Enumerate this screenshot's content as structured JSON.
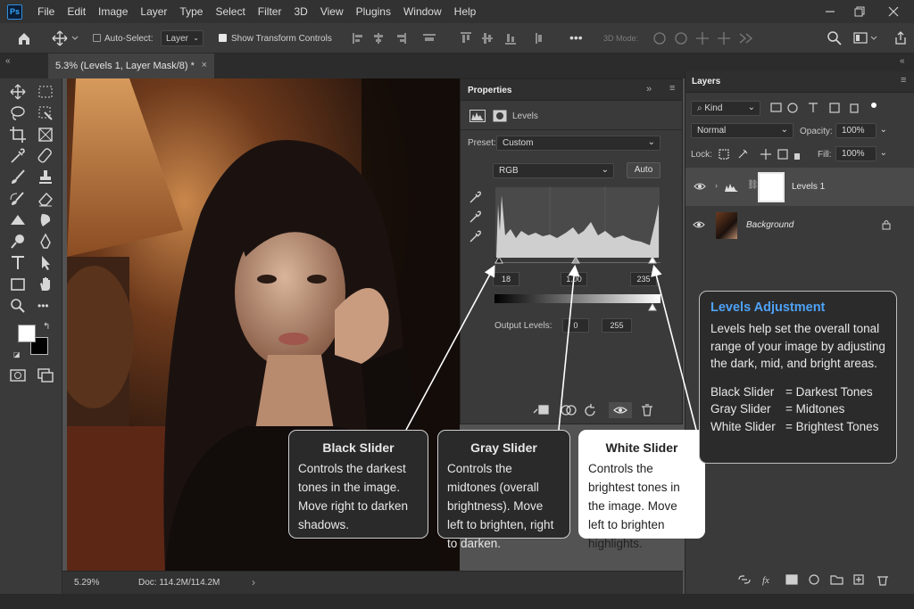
{
  "app": {
    "logo": "Ps"
  },
  "menubar": {
    "items": [
      "File",
      "Edit",
      "Image",
      "Layer",
      "Type",
      "Select",
      "Filter",
      "3D",
      "View",
      "Plugins",
      "Window",
      "Help"
    ]
  },
  "options_bar": {
    "auto_select_label": "Auto-Select:",
    "auto_select_target": "Layer",
    "show_transform_label": "Show Transform Controls",
    "mode_3d_label": "3D Mode:"
  },
  "document": {
    "tab_title": "5.3% (Levels 1, Layer Mask/8) *",
    "close": "×",
    "collapse": "«"
  },
  "status": {
    "zoom": "5.29%",
    "doc": "Doc: 114.2M/114.2M",
    "arrow": "›"
  },
  "properties": {
    "tab_label": "Properties",
    "adjustment_label": "Levels",
    "preset_label": "Preset:",
    "preset_value": "Custom",
    "channel_value": "RGB",
    "auto_label": "Auto",
    "input_black": "18",
    "input_gamma": "1.00",
    "input_white": "235",
    "output_label": "Output Levels:",
    "output_black": "0",
    "output_white": "255"
  },
  "layers": {
    "tab_label": "Layers",
    "kind_label": "Kind",
    "blend_mode": "Normal",
    "opacity_label": "Opacity:",
    "opacity_value": "100%",
    "lock_label": "Lock:",
    "fill_label": "Fill:",
    "fill_value": "100%",
    "items": [
      {
        "name": "Levels 1",
        "selected": true
      },
      {
        "name": "Background",
        "selected": false
      }
    ]
  },
  "callouts": {
    "black": {
      "title": "Black Slider",
      "body": "Controls the darkest tones in the image. Move right to darken shadows."
    },
    "gray": {
      "title": "Gray Slider",
      "body": "Controls the midtones (overall brightness). Move left to brighten, right to darken."
    },
    "white": {
      "title": "White Slider",
      "body": "Controls the brightest tones in the image. Move left to brighten highlights."
    }
  },
  "info_panel": {
    "title": "Levels Adjustment",
    "body": "Levels help set the overall tonal range of your image by adjusting the dark, mid, and bright areas.",
    "legend": [
      {
        "key": "Black Slider",
        "value": "= Darkest Tones"
      },
      {
        "key": "Gray Slider",
        "value": "= Midtones"
      },
      {
        "key": "White Slider",
        "value": "= Brightest Tones"
      }
    ]
  },
  "colors": {
    "accent": "#4ea2f7",
    "panel": "#3a3a3a",
    "menubar": "#323232"
  }
}
